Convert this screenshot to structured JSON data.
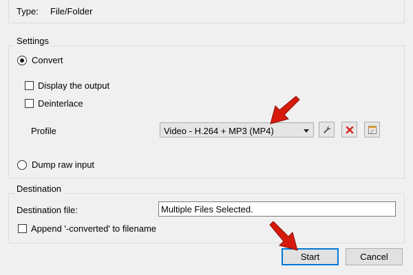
{
  "source": {
    "type_label": "Type:",
    "type_value": "File/Folder"
  },
  "settings": {
    "title": "Settings",
    "convert_label": "Convert",
    "convert_checked": true,
    "display_output_label": "Display the output",
    "display_output_checked": false,
    "deinterlace_label": "Deinterlace",
    "deinterlace_checked": false,
    "profile_label": "Profile",
    "profile_value": "Video - H.264 + MP3 (MP4)",
    "dump_raw_label": "Dump raw input",
    "dump_raw_checked": false,
    "icons": [
      "wrench-icon",
      "delete-icon",
      "new-profile-icon"
    ]
  },
  "destination": {
    "title": "Destination",
    "file_label": "Destination file:",
    "file_value": "Multiple Files Selected.",
    "append_label": "Append '-converted' to filename",
    "append_checked": false
  },
  "buttons": {
    "start_label": "Start",
    "cancel_label": "Cancel"
  },
  "colors": {
    "annotation_arrow": "#d61a0c",
    "default_button_border": "#0078d7",
    "delete_icon": "#d8231b"
  }
}
